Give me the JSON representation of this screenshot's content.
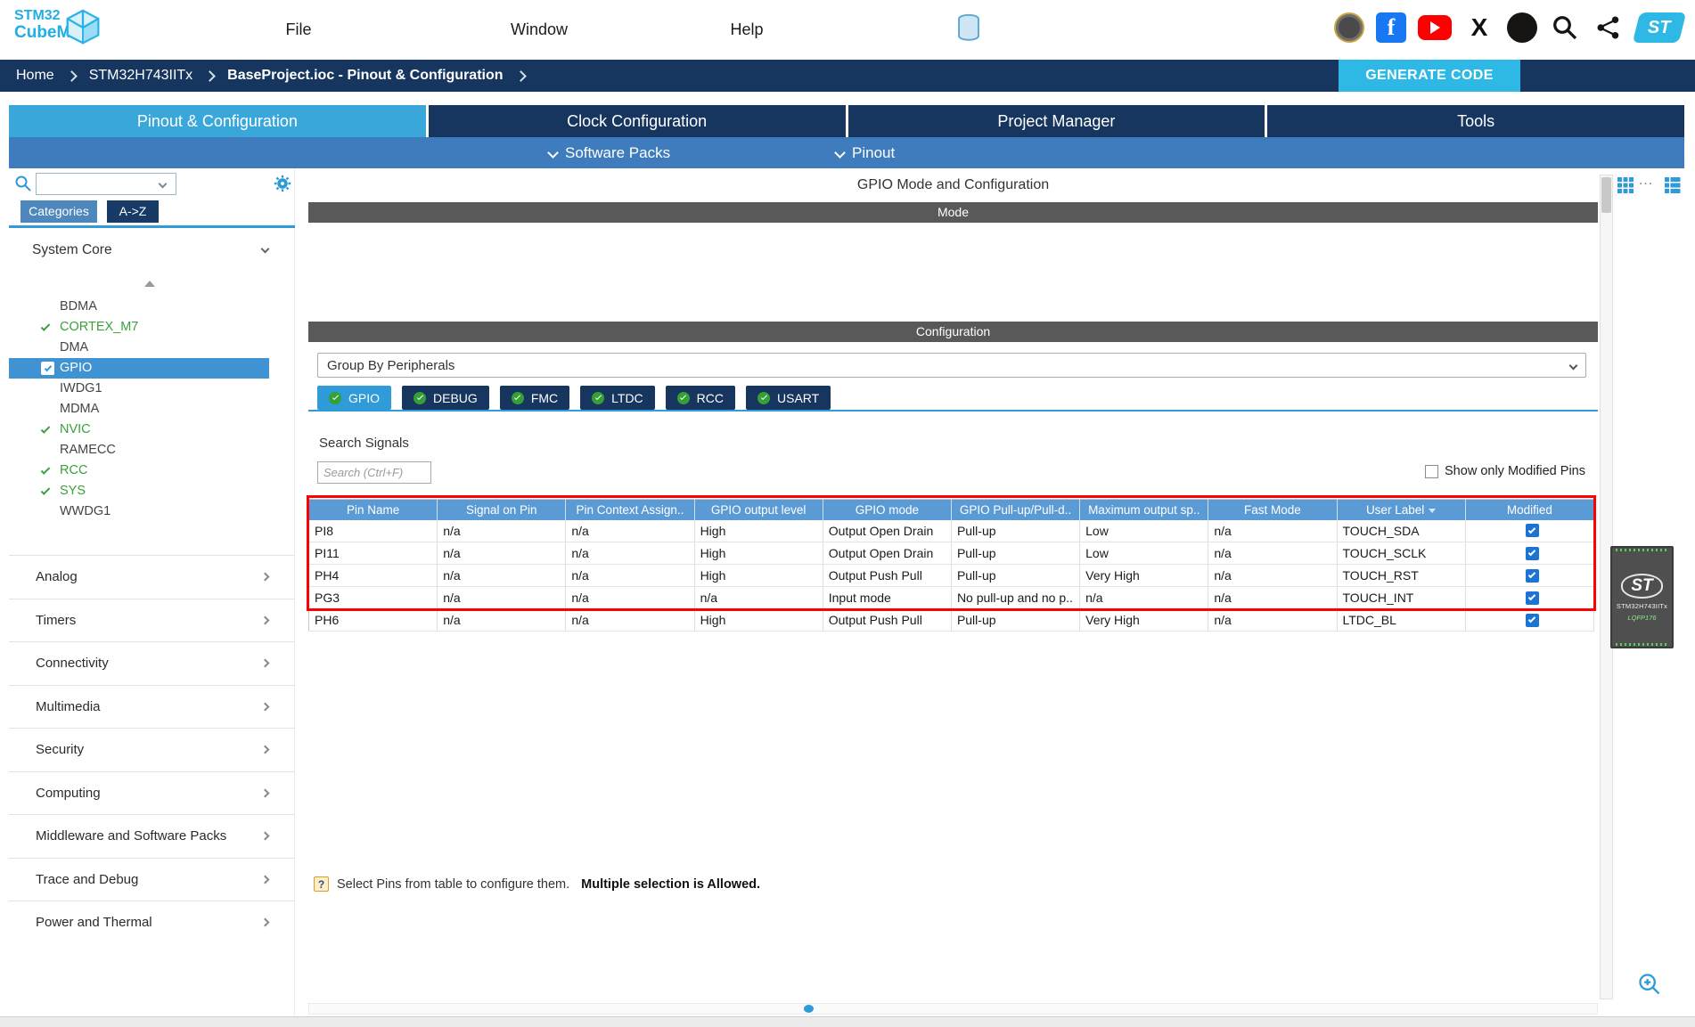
{
  "topbar": {
    "logo_top": "STM32",
    "logo_bottom": "CubeMX",
    "menus": [
      "File",
      "Window",
      "Help"
    ],
    "social_icons": [
      "anniversary-badge",
      "facebook",
      "youtube",
      "x-twitter",
      "github",
      "search",
      "share-nodes",
      "st-logo"
    ]
  },
  "breadcrumb": {
    "items": [
      "Home",
      "STM32H743IITx",
      "BaseProject.ioc - Pinout & Configuration"
    ],
    "generate_button": "GENERATE CODE"
  },
  "main_tabs": [
    "Pinout & Configuration",
    "Clock Configuration",
    "Project Manager",
    "Tools"
  ],
  "active_main_tab": "Pinout & Configuration",
  "subnav": [
    "Software Packs",
    "Pinout"
  ],
  "sidebar": {
    "tabs": [
      "Categories",
      "A->Z"
    ],
    "active_tab": "Categories",
    "group_label": "System Core",
    "tree": [
      {
        "label": "BDMA",
        "state": "plain"
      },
      {
        "label": "CORTEX_M7",
        "state": "enabled"
      },
      {
        "label": "DMA",
        "state": "plain"
      },
      {
        "label": "GPIO",
        "state": "selected"
      },
      {
        "label": "IWDG1",
        "state": "plain"
      },
      {
        "label": "MDMA",
        "state": "plain"
      },
      {
        "label": "NVIC",
        "state": "enabled"
      },
      {
        "label": "RAMECC",
        "state": "plain"
      },
      {
        "label": "RCC",
        "state": "enabled"
      },
      {
        "label": "SYS",
        "state": "enabled"
      },
      {
        "label": "WWDG1",
        "state": "plain"
      }
    ],
    "categories": [
      "Analog",
      "Timers",
      "Connectivity",
      "Multimedia",
      "Security",
      "Computing",
      "Middleware and Software Packs",
      "Trace and Debug",
      "Power and Thermal"
    ]
  },
  "content": {
    "section_title": "GPIO Mode and Configuration",
    "mode_bar": "Mode",
    "configuration_bar": "Configuration",
    "group_by": "Group By Peripherals",
    "peripheral_tabs": [
      "GPIO",
      "DEBUG",
      "FMC",
      "LTDC",
      "RCC",
      "USART"
    ],
    "active_peripheral": "GPIO",
    "search_signals_label": "Search Signals",
    "search_placeholder": "Search (Ctrl+F)",
    "show_only_modified": "Show only Modified Pins",
    "table": {
      "columns": [
        "Pin Name",
        "Signal on Pin",
        "Pin Context Assign..",
        "GPIO output level",
        "GPIO mode",
        "GPIO Pull-up/Pull-d..",
        "Maximum output sp..",
        "Fast Mode",
        "User Label",
        "Modified"
      ],
      "sorted_column": "User Label",
      "rows": [
        {
          "cells": [
            "PI8",
            "n/a",
            "n/a",
            "High",
            "Output Open Drain",
            "Pull-up",
            "Low",
            "n/a",
            "TOUCH_SDA"
          ],
          "modified": true
        },
        {
          "cells": [
            "PI11",
            "n/a",
            "n/a",
            "High",
            "Output Open Drain",
            "Pull-up",
            "Low",
            "n/a",
            "TOUCH_SCLK"
          ],
          "modified": true
        },
        {
          "cells": [
            "PH4",
            "n/a",
            "n/a",
            "High",
            "Output Push Pull",
            "Pull-up",
            "Very High",
            "n/a",
            "TOUCH_RST"
          ],
          "modified": true
        },
        {
          "cells": [
            "PG3",
            "n/a",
            "n/a",
            "n/a",
            "Input mode",
            "No pull-up and no p..",
            "n/a",
            "n/a",
            "TOUCH_INT"
          ],
          "modified": true
        },
        {
          "cells": [
            "PH6",
            "n/a",
            "n/a",
            "High",
            "Output Push Pull",
            "Pull-up",
            "Very High",
            "n/a",
            "LTDC_BL"
          ],
          "modified": true
        }
      ]
    },
    "note_text": "Select Pins from table to configure them.",
    "note_bold": "Multiple selection is Allowed."
  },
  "right_panel": {
    "chip_logo": "ST",
    "chip_name": "STM32H743IITx",
    "chip_package": "LQFP176"
  },
  "colors": {
    "navy": "#16365f",
    "accent_blue": "#2f9bd8",
    "cyan": "#2eb8e6",
    "table_header": "#5b9bd5",
    "green_check": "#3ca03c",
    "highlight_red": "#ff0000"
  }
}
